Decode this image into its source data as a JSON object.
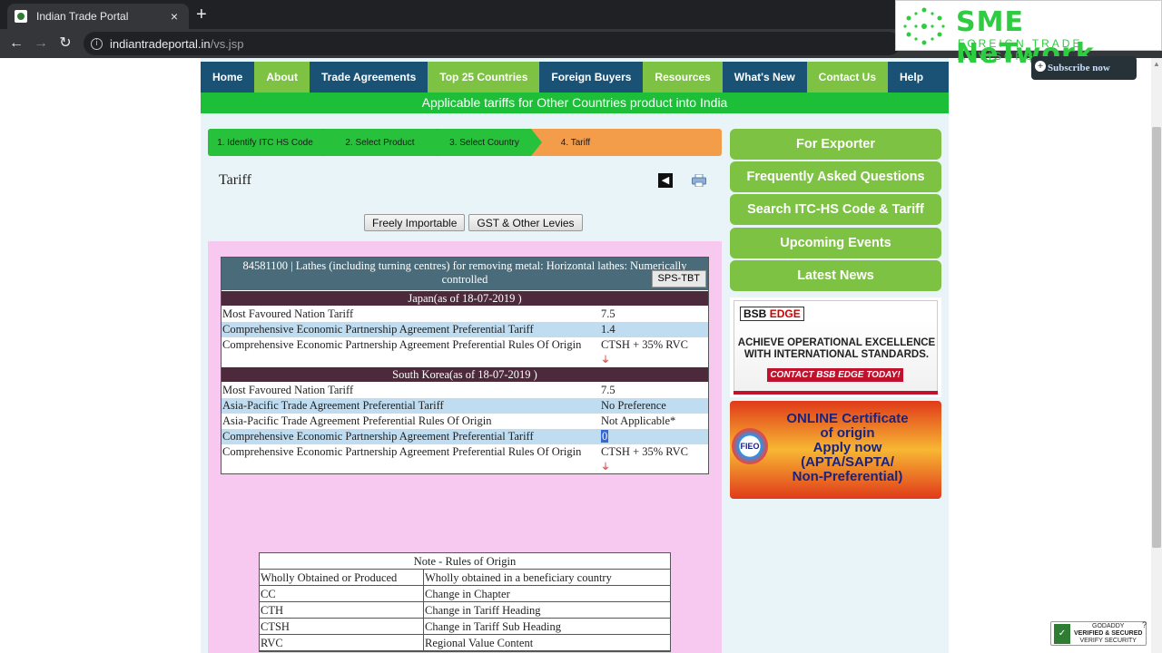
{
  "browser": {
    "tab_title": "Indian Trade Portal",
    "url_domain": "indiantradeportal.in",
    "url_path": "/vs.jsp"
  },
  "overlay": {
    "brand": "SME NeTwork",
    "tagline": "FOREIGN TRADE ADVISORS",
    "subscribe": "Subscribe now"
  },
  "nav": {
    "items": [
      "Home",
      "About",
      "Trade Agreements",
      "Top 25 Countries",
      "Foreign Buyers",
      "Resources",
      "What's New",
      "Contact Us",
      "Help"
    ]
  },
  "subheading": "Applicable tariffs for Other Countries product into India",
  "steps": [
    "1. Identify ITC HS Code",
    "2. Select Product",
    "3. Select Country",
    "4. Tariff"
  ],
  "page_title": "Tariff",
  "buttons": {
    "freely_importable": "Freely Importable",
    "gst": "GST & Other Levies"
  },
  "product": {
    "header": "84581100 | Lathes (including turning centres) for removing metal: Horizontal lathes: Numerically controlled",
    "sps_button": "SPS-TBT"
  },
  "japan": {
    "title": "Japan(as of 18-07-2019 )",
    "rows": [
      {
        "k": "Most Favoured Nation Tariff",
        "v": "7.5"
      },
      {
        "k": "Comprehensive Economic Partnership Agreement Preferential Tariff",
        "v": "1.4"
      },
      {
        "k": "Comprehensive Economic Partnership Agreement Preferential Rules Of Origin",
        "v": "CTSH + 35% RVC"
      }
    ]
  },
  "korea": {
    "title": "South Korea(as of 18-07-2019 )",
    "rows": [
      {
        "k": "Most Favoured Nation Tariff",
        "v": "7.5"
      },
      {
        "k": "Asia-Pacific Trade Agreement Preferential Tariff",
        "v": "No Preference"
      },
      {
        "k": "Asia-Pacific Trade Agreement Preferential Rules Of Origin",
        "v": "Not Applicable*"
      },
      {
        "k": "Comprehensive Economic Partnership Agreement Preferential Tariff",
        "v": "0"
      },
      {
        "k": "Comprehensive Economic Partnership Agreement Preferential Rules Of Origin",
        "v": "CTSH + 35% RVC"
      }
    ]
  },
  "note": {
    "title": "Note - Rules of Origin",
    "rows": [
      {
        "a": "Wholly Obtained or Produced",
        "b": "Wholly obtained in a beneficiary country"
      },
      {
        "a": "CC",
        "b": "Change in Chapter"
      },
      {
        "a": "CTH",
        "b": "Change in Tariff Heading"
      },
      {
        "a": "CTSH",
        "b": "Change in Tariff Sub Heading"
      },
      {
        "a": "RVC",
        "b": "Regional Value Content"
      }
    ]
  },
  "sidebar": {
    "items": [
      "For Exporter",
      "Frequently Asked Questions",
      "Search ITC-HS Code & Tariff",
      "Upcoming Events",
      "Latest News"
    ]
  },
  "ads": {
    "bsb_logo_a": "BSB",
    "bsb_logo_b": "EDGE",
    "bsb_line1": "ACHIEVE OPERATIONAL EXCELLENCE",
    "bsb_line2": "WITH INTERNATIONAL STANDARDS.",
    "bsb_cta": "CONTACT BSB EDGE TODAY!",
    "fieo_logo": "FIEO",
    "fieo_text1": "ONLINE Certificate",
    "fieo_text2": "of origin",
    "fieo_text3": "Apply now",
    "fieo_text4": "(APTA/SAPTA/",
    "fieo_text5": "Non-Preferential)"
  },
  "seal": {
    "line1": "GODADDY",
    "line2": "VERIFIED & SECURED",
    "line3": "VERIFY SECURITY"
  },
  "colors": {
    "nav_blue": "#1a5276",
    "nav_green": "#7dc242",
    "subhead_green": "#1dbe38",
    "step_orange": "#f39c4a",
    "pink_bg": "#f7c8f0",
    "country_header": "#4d2a3b"
  }
}
